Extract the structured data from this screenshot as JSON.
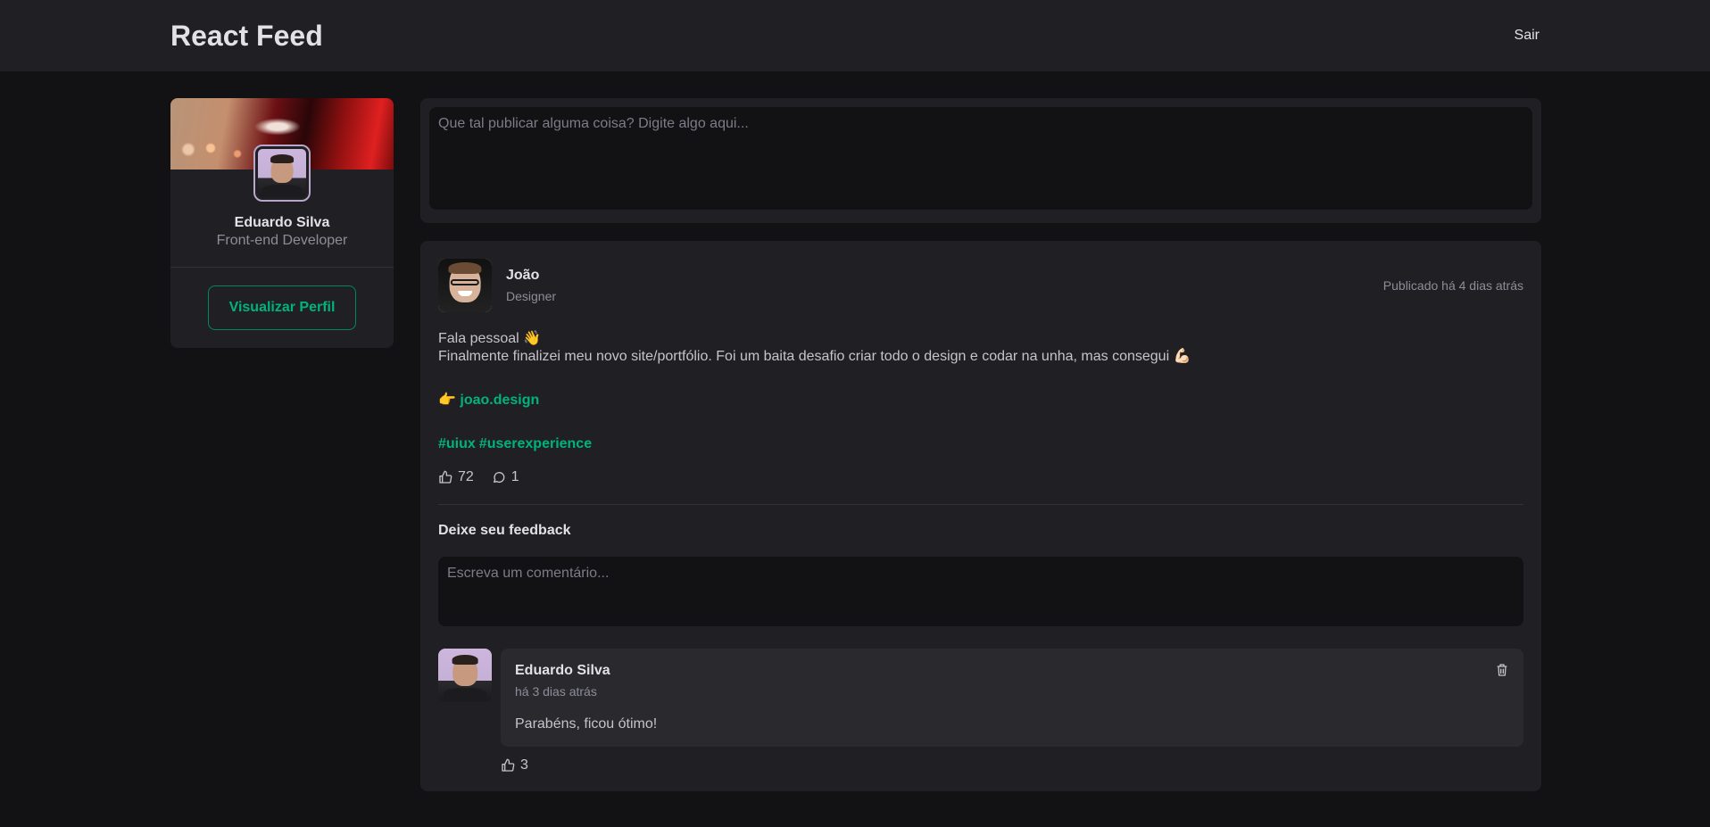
{
  "header": {
    "title": "React Feed",
    "logout_label": "Sair"
  },
  "profile": {
    "name": "Eduardo Silva",
    "role": "Front-end Developer",
    "button_label": "Visualizar Perfil"
  },
  "composer": {
    "placeholder": "Que tal publicar alguma coisa? Digite algo aqui..."
  },
  "post": {
    "author_name": "João",
    "author_role": "Designer",
    "published": "Publicado há 4 dias atrás",
    "line1": "Fala pessoal 👋",
    "line2": "Finalmente finalizei meu novo site/portfólio. Foi um baita desafio criar todo o design e codar na unha, mas consegui 💪🏻",
    "link_prefix": "👉",
    "link": "joao.design",
    "tags": [
      "#uiux",
      "#userexperience"
    ],
    "likes": "72",
    "comments": "1",
    "feedback_title": "Deixe seu feedback",
    "comment_placeholder": "Escreva um comentário..."
  },
  "comment": {
    "author_name": "Eduardo Silva",
    "time": "há 3 dias atrás",
    "text": "Parabéns, ficou ótimo!",
    "likes": "3"
  },
  "colors": {
    "accent": "#00b37e",
    "accent_border": "#00875f",
    "background": "#121214",
    "surface": "#202024"
  },
  "icons": [
    "thumbs-up-icon",
    "chat-bubble-icon",
    "trash-icon"
  ]
}
